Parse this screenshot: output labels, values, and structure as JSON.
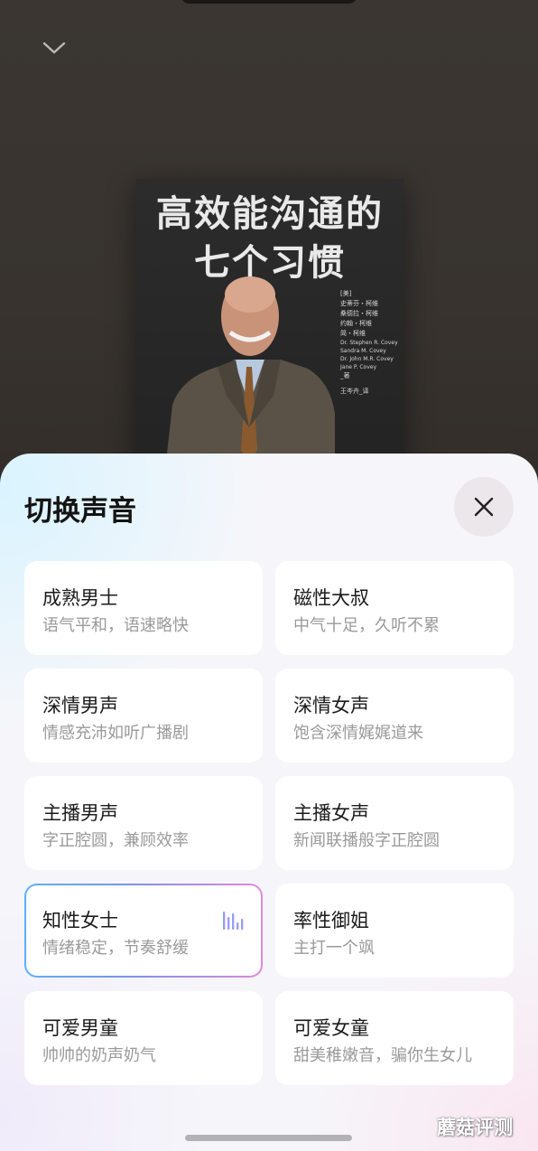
{
  "player": {
    "collapse_icon": "chevron-down-icon",
    "book": {
      "title_line1": "高效能沟通的",
      "title_line2": "七个习惯",
      "credits": [
        "[美]",
        "史蒂芬・柯维",
        "桑德拉・柯维",
        "约翰・柯维",
        "简・柯维",
        "Dr. Stephen R. Covey",
        "Sandra M. Covey",
        "Dr. John M.R. Covey",
        "Jane P. Covey",
        "_著",
        "王岑卉_译"
      ]
    }
  },
  "voice_sheet": {
    "title": "切换声音",
    "close_icon": "close-icon",
    "voices": [
      {
        "name": "成熟男士",
        "desc": "语气平和，语速略快",
        "selected": false
      },
      {
        "name": "磁性大叔",
        "desc": "中气十足，久听不累",
        "selected": false
      },
      {
        "name": "深情男声",
        "desc": "情感充沛如听广播剧",
        "selected": false
      },
      {
        "name": "深情女声",
        "desc": "饱含深情娓娓道来",
        "selected": false
      },
      {
        "name": "主播男声",
        "desc": "字正腔圆，兼顾效率",
        "selected": false
      },
      {
        "name": "主播女声",
        "desc": "新闻联播般字正腔圆",
        "selected": false
      },
      {
        "name": "知性女士",
        "desc": "情绪稳定，节奏舒缓",
        "selected": true
      },
      {
        "name": "率性御姐",
        "desc": "主打一个飒",
        "selected": false
      },
      {
        "name": "可爱男童",
        "desc": "帅帅的奶声奶气",
        "selected": false
      },
      {
        "name": "可爱女童",
        "desc": "甜美稚嫩音，骗你生女儿",
        "selected": false
      }
    ],
    "playing_icon": "audio-wave-icon"
  },
  "watermark": "蘑菇评测",
  "colors": {
    "selected_border_start": "#5bb0ff",
    "selected_border_end": "#e08ad8",
    "card_bg": "#ffffff",
    "sheet_bg": "#f6f6fa"
  }
}
